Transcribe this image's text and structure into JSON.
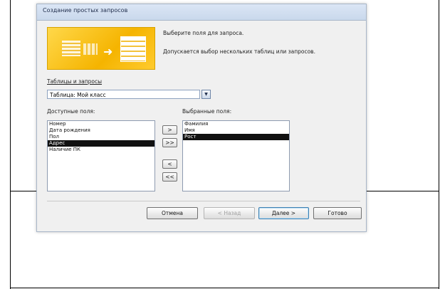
{
  "dialog": {
    "title": "Создание простых запросов",
    "instruction1": "Выберите поля для запроса.",
    "instruction2": "Допускается выбор нескольких таблиц или запросов."
  },
  "tables": {
    "label": "Таблицы и запросы",
    "selected": "Таблица: Мой класс"
  },
  "available": {
    "label": "Доступные поля:",
    "items": [
      "Номер",
      "Дата рождения",
      "Пол",
      "Адрес",
      "Наличие ПК"
    ],
    "selected_index": 3
  },
  "chosen": {
    "label": "Выбранные поля:",
    "items": [
      "Фамилия",
      "Имя",
      "Рост"
    ],
    "selected_index": 2
  },
  "move_buttons": {
    "add_one": ">",
    "add_all": ">>",
    "remove_one": "<",
    "remove_all": "<<"
  },
  "footer": {
    "cancel": "Отмена",
    "back": "< Назад",
    "next": "Далее >",
    "finish": "Готово"
  },
  "colors": {
    "selection": "#111111",
    "title_bar": "#c9d8ec",
    "wizard_image": "#f5b400"
  }
}
